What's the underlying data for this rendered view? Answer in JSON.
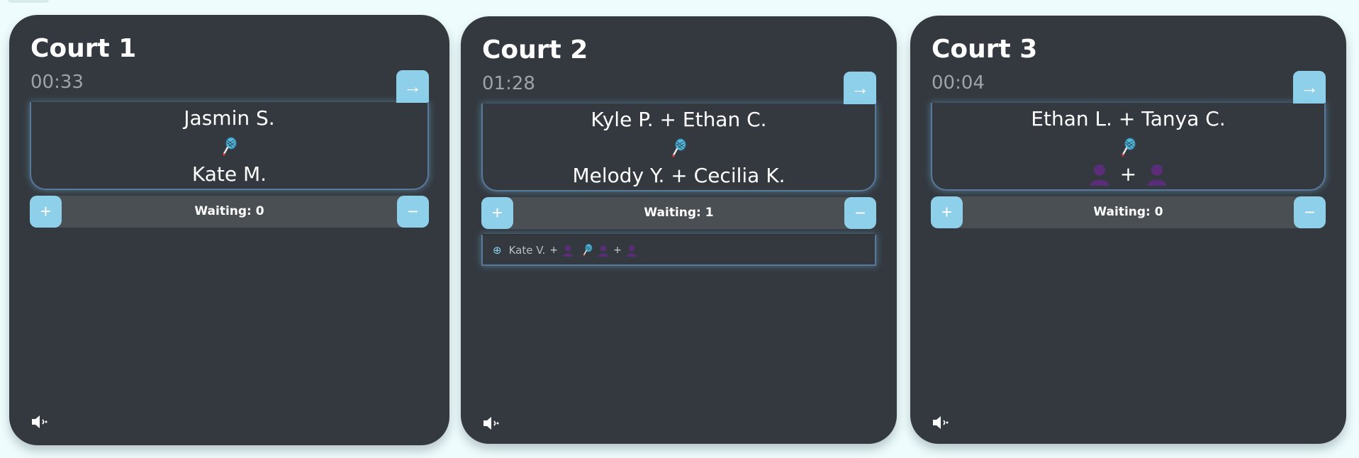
{
  "courts": [
    {
      "title": "Court 1",
      "timer": "00:33",
      "team_a": "Jasmin S.",
      "team_b": "Kate M.",
      "waiting_label": "Waiting: 0"
    },
    {
      "title": "Court 2",
      "timer": "01:28",
      "team_a": "Kyle P. + Ethan C.",
      "team_b": "Melody Y. + Cecilia K.",
      "waiting_label": "Waiting: 1",
      "queue": [
        {
          "player": "Kate V.",
          "separator": "+"
        }
      ]
    },
    {
      "title": "Court 3",
      "timer": "00:04",
      "team_a": "Ethan L. + Tanya C.",
      "team_b_separator": "+",
      "waiting_label": "Waiting: 0"
    }
  ],
  "icons": {
    "next": "arrow-right-icon",
    "add": "plus-icon",
    "remove": "minus-icon",
    "versus": "badminton-racket-icon",
    "empty_slot": "person-placeholder-icon",
    "queue_entry": "add-circle-icon",
    "sound": "speaker-icon"
  },
  "symbols": {
    "next": "→",
    "add": "+",
    "remove": "−",
    "queue_entry": "⊕"
  },
  "colors": {
    "background": "#effcfd",
    "card": "#343940",
    "accent": "#8ed0ea",
    "muted_text": "#9ea3a9",
    "placeholder_purple": "#5a2d78"
  }
}
